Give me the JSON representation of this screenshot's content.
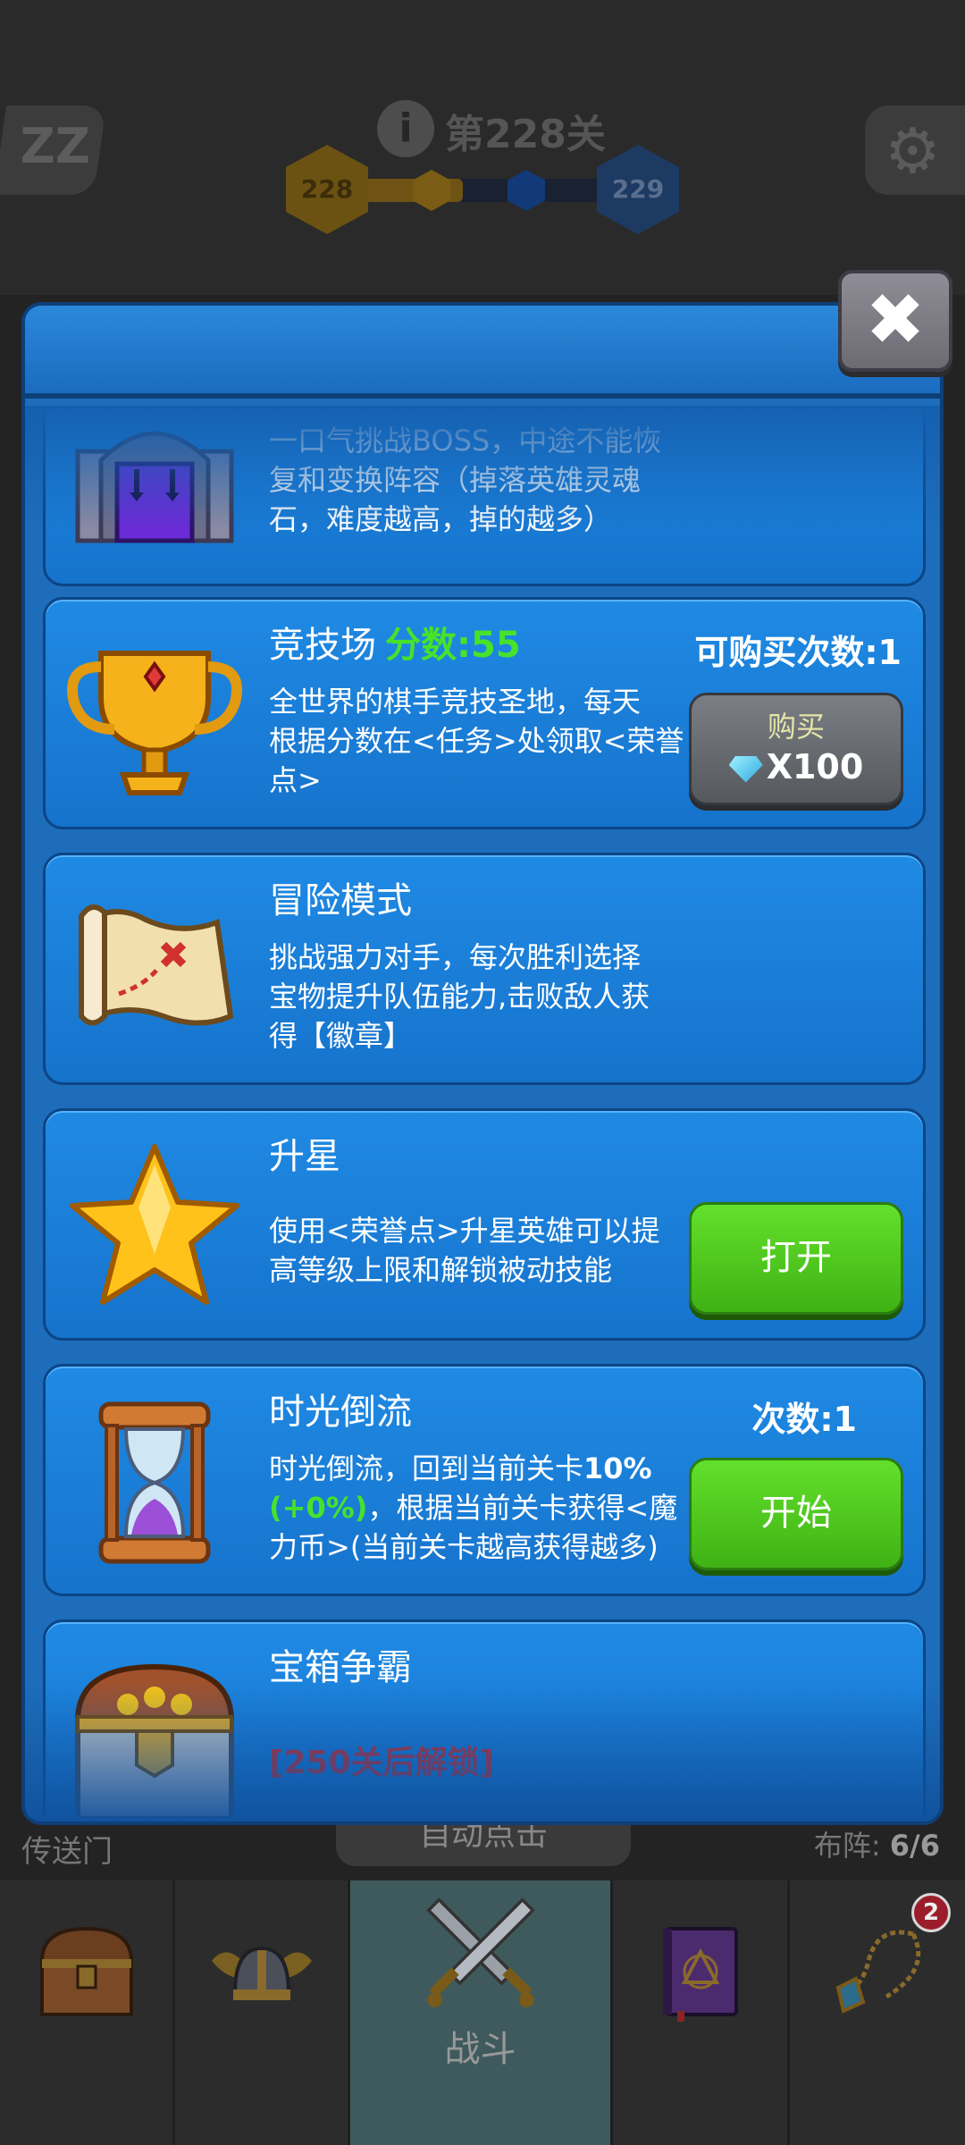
{
  "hud": {
    "sleep_icon": "ZZ",
    "settings_icon": "gear-icon",
    "info_icon": "i",
    "level_title": "第228关",
    "current_level": "228",
    "next_level": "229",
    "progress": 0.4
  },
  "panel": {
    "close_icon": "✖",
    "cards": [
      {
        "id": "boss",
        "desc_lines": [
          "一口气挑战BOSS，中途不能恢",
          "复和变换阵容（掉落英雄灵魂",
          "石，难度越高，掉的越多）"
        ]
      },
      {
        "id": "arena",
        "title": "竞技场",
        "score": "分数:55",
        "desc_lines": [
          "全世界的棋手竞技圣地，每天",
          "根据分数在<任务>处领取<荣誉",
          "点>"
        ],
        "purchase_count": "可购买次数:1",
        "button_label": "购买",
        "button_price": "X100"
      },
      {
        "id": "adventure",
        "title": "冒险模式",
        "desc_lines": [
          "挑战强力对手，每次胜利选择",
          "宝物提升队伍能力,击败敌人获",
          "得【徽章】"
        ]
      },
      {
        "id": "star",
        "title": "升星",
        "desc_lines": [
          "使用<荣誉点>升星英雄可以提",
          "高等级上限和解锁被动技能"
        ],
        "button_label": "打开"
      },
      {
        "id": "rewind",
        "title": "时光倒流",
        "desc_part1": "时光倒流，回到当前关卡",
        "desc_pct": "10%",
        "desc_bonus": "(+0%)",
        "desc_part2": "，根据当前关卡获得<魔力币>(当前关卡越高获得越多)",
        "count": "次数:1",
        "button_label": "开始"
      },
      {
        "id": "chest",
        "title": "宝箱争霸",
        "locked": "[250关后解锁]"
      }
    ]
  },
  "under": {
    "portal": "传送门",
    "auto_click": "自动点击",
    "deploy_label": "布阵:",
    "deploy_value": "6/6"
  },
  "nav": {
    "tabs": [
      {
        "icon": "treasure-chest-icon",
        "label": ""
      },
      {
        "icon": "winged-helmet-icon",
        "label": ""
      },
      {
        "icon": "crossed-swords-icon",
        "label": "战斗"
      },
      {
        "icon": "spellbook-icon",
        "label": ""
      },
      {
        "icon": "amulet-icon",
        "label": "",
        "badge": "2"
      }
    ]
  },
  "colors": {
    "panel_blue": "#1d6dbb",
    "green_button": "#47c51c",
    "score_green": "#47e22b",
    "locked_red": "#d42a2a"
  }
}
